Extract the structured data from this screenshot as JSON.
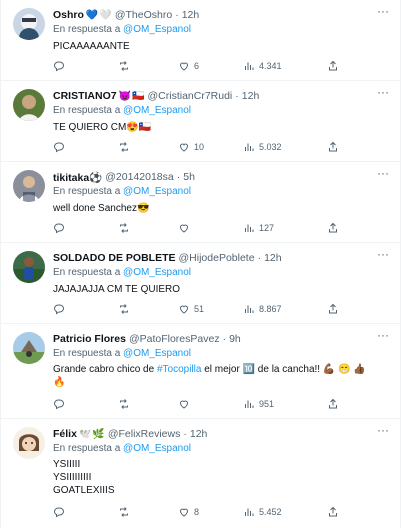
{
  "reply_prefix": "En respuesta a",
  "reply_to": "@OM_Espanol",
  "tweets": [
    {
      "name": "Oshro",
      "badges": [
        "💙",
        "🤍"
      ],
      "handle": "@TheOshro",
      "time": "12h",
      "lines": [
        "PICAAAAAANTE"
      ],
      "replies": "",
      "retweets": "",
      "likes": "6",
      "views": "4.341",
      "avatar_color": "#c8d6e5"
    },
    {
      "name": "CRISTIANO7",
      "badges": [
        "😈",
        "🇨🇱"
      ],
      "handle": "@CristianCr7Rudi",
      "time": "12h",
      "lines": [
        "TE QUIERO CM😍🇨🇱"
      ],
      "replies": "",
      "retweets": "",
      "likes": "10",
      "views": "5.032",
      "avatar_color": "#5a7a3a"
    },
    {
      "name": "tikitaka⚽",
      "badges": [],
      "handle": "@20142018sa",
      "time": "5h",
      "lines": [
        "well done Sanchez😎"
      ],
      "replies": "",
      "retweets": "",
      "likes": "",
      "views": "127",
      "avatar_color": "#8a8f99"
    },
    {
      "name": "SOLDADO DE POBLETE",
      "badges": [],
      "handle": "@HijodePoblete",
      "time": "12h",
      "lines": [
        "JAJAJAJJA CM TE QUIERO"
      ],
      "replies": "",
      "retweets": "",
      "likes": "51",
      "views": "8.867",
      "avatar_color": "#3d6b4a"
    },
    {
      "name": "Patricio Flores",
      "badges": [],
      "handle": "@PatoFloresPavez",
      "time": "9h",
      "lines": [
        "Grande cabro chico de #Tocopilla el mejor 🔟 de la cancha!! 💪🏾 😁 👍🏾",
        "🔥"
      ],
      "replies": "",
      "retweets": "",
      "likes": "",
      "views": "951",
      "avatar_color": "#7fa66a"
    },
    {
      "name": "Félix",
      "badges": [
        "🕊️",
        "🌿"
      ],
      "handle": "@FelixReviews",
      "time": "12h",
      "lines": [
        "YSIIIII",
        "YSIIIIIIIII",
        "GOATLEXIIIS"
      ],
      "replies": "",
      "retweets": "",
      "likes": "8",
      "views": "5.452",
      "avatar_color": "#e9dcc8"
    }
  ]
}
